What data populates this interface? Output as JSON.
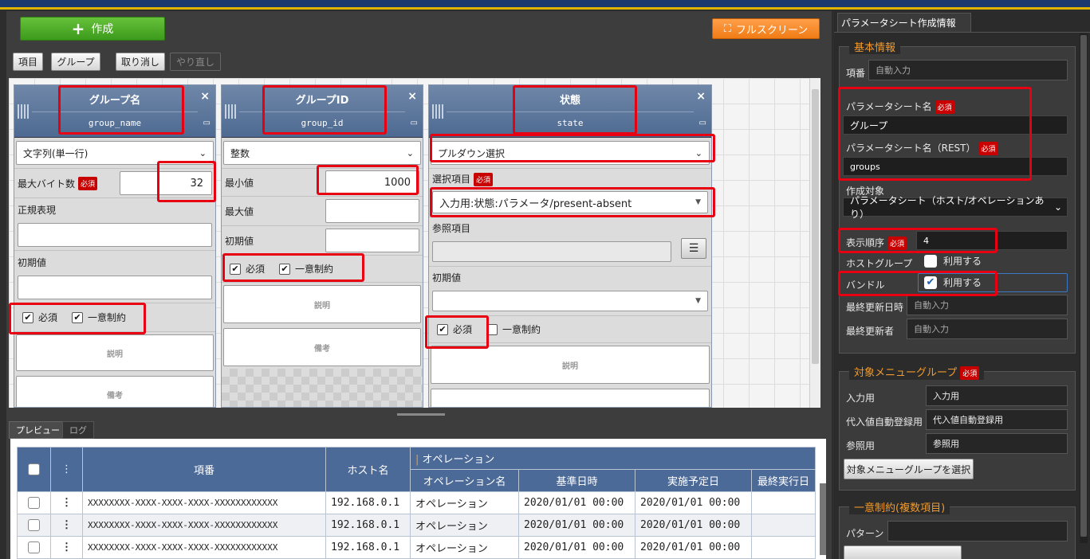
{
  "toolbar": {
    "create_label": "作成",
    "fullscreen_label": "フルスクリーン",
    "btn_item": "項目",
    "btn_group": "グループ",
    "btn_undo": "取り消し",
    "btn_redo": "やり直し"
  },
  "columns": [
    {
      "name": "グループ名",
      "id": "group_name",
      "type": "文字列(単一行)",
      "maxbytes_label": "最大バイト数",
      "maxbytes_value": "32",
      "regex_label": "正規表現",
      "default_label": "初期値",
      "required": "必須",
      "unique": "一意制約",
      "desc": "説明",
      "note": "備考"
    },
    {
      "name": "グループID",
      "id": "group_id",
      "type": "整数",
      "min_label": "最小値",
      "min_value": "1000",
      "max_label": "最大値",
      "default_label": "初期値",
      "required": "必須",
      "unique": "一意制約",
      "desc": "説明",
      "note": "備考"
    },
    {
      "name": "状態",
      "id": "state",
      "type": "プルダウン選択",
      "select_label": "選択項目",
      "select_value": "入力用:状態:パラメータ/present-absent",
      "ref_label": "参照項目",
      "default_label": "初期値",
      "required": "必須",
      "unique": "一意制約",
      "desc": "説明"
    }
  ],
  "required_badge": "必須",
  "bottom": {
    "tabs": [
      "プレビュー",
      "ログ"
    ],
    "headers": {
      "no": "項番",
      "host": "ホスト名",
      "operation_group": "オペレーション",
      "op_name": "オペレーション名",
      "base_date": "基準日時",
      "scheduled": "実施予定日",
      "last_exec": "最終実行日"
    },
    "rows": [
      {
        "no": "XXXXXXXX-XXXX-XXXX-XXXX-XXXXXXXXXXXX",
        "host": "192.168.0.1",
        "op": "オペレーション",
        "base": "2020/01/01 00:00",
        "sched": "2020/01/01 00:00"
      },
      {
        "no": "XXXXXXXX-XXXX-XXXX-XXXX-XXXXXXXXXXXX",
        "host": "192.168.0.1",
        "op": "オペレーション",
        "base": "2020/01/01 00:00",
        "sched": "2020/01/01 00:00"
      },
      {
        "no": "XXXXXXXX-XXXX-XXXX-XXXX-XXXXXXXXXXXX",
        "host": "192.168.0.1",
        "op": "オペレーション",
        "base": "2020/01/01 00:00",
        "sched": "2020/01/01 00:00"
      }
    ]
  },
  "panel": {
    "tab": "パラメータシート作成情報",
    "basic_title": "基本情報",
    "no_label": "項番",
    "no_value": "自動入力",
    "sheet_name_label": "パラメータシート名",
    "sheet_name_value": "グループ",
    "sheet_rest_label": "パラメータシート名（REST）",
    "sheet_rest_value": "groups",
    "target_label": "作成対象",
    "target_value": "パラメータシート（ホスト/オペレーションあり）",
    "order_label": "表示順序",
    "order_value": "4",
    "hostgroup_label": "ホストグループ",
    "hostgroup_use": "利用する",
    "bundle_label": "バンドル",
    "bundle_use": "利用する",
    "updated_label": "最終更新日時",
    "updated_value": "自動入力",
    "updater_label": "最終更新者",
    "updater_value": "自動入力",
    "menu_title": "対象メニューグループ",
    "input_label": "入力用",
    "input_value": "入力用",
    "subst_label": "代入値自動登録用",
    "subst_value": "代入値自動登録用",
    "ref_label": "参照用",
    "ref_value": "参照用",
    "select_menu_btn": "対象メニューグループを選択",
    "unique_title": "一意制約(複数項目)",
    "pattern_label": "パターン"
  },
  "colors": {
    "accent": "#f39a2a",
    "header_blue": "#4c6a98",
    "required_red": "#c80000",
    "highlight": "#e60012"
  }
}
